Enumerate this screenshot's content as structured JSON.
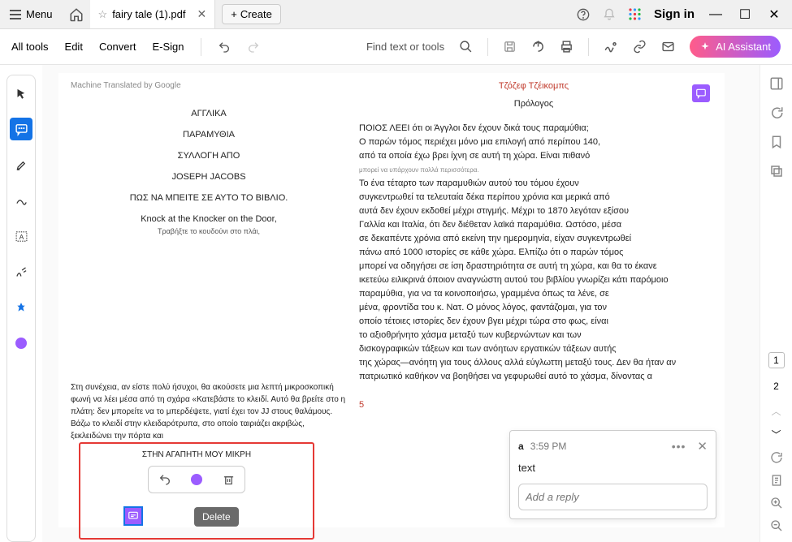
{
  "titlebar": {
    "menu": "Menu",
    "tab_title": "fairy tale (1).pdf",
    "create": "Create",
    "signin": "Sign in"
  },
  "toolbar": {
    "all_tools": "All tools",
    "edit": "Edit",
    "convert": "Convert",
    "esign": "E-Sign",
    "search_label": "Find text or tools",
    "ai": "AI Assistant"
  },
  "doc": {
    "mt": "Machine Translated by Google",
    "left": {
      "l1": "ΑΓΓΛΙΚΑ",
      "l2": "ΠΑΡΑΜΥΘΙΑ",
      "l3": "ΣΥΛΛΟΓΗ ΑΠΟ",
      "l4": "JOSEPH JACOBS",
      "l5": "ΠΩΣ ΝΑ ΜΠΕΙΤΕ ΣΕ ΑΥΤΟ ΤΟ ΒΙΒΛΙΟ.",
      "l6": "Knock at the Knocker on the Door,",
      "l6s": "Τραβήξτε το κουδούνι στο πλάι,"
    },
    "narrative": "Στη συνέχεια, αν είστε πολύ ήσυχοι, θα ακούσετε μια λεπτή μικροσκοπική φωνή να λέει μέσα από τη σχάρα «Κατεβάστε το κλειδί.    Αυτό θα βρείτε στο η πλάτη: δεν μπορείτε να το μπερδέψετε, γιατί έχει τον JJ στους θαλάμους. Βάζω το κλειδί στην κλειδαρότρυπα, στο οποίο ταιριάζει ακριβώς, ξεκλειδώνει την πόρτα και",
    "hl": {
      "title": "ΣΤΗΝ ΑΓΑΠΗΤΗ ΜΟΥ ΜΙΚΡΗ",
      "delete": "Delete"
    },
    "right": {
      "author": "Τζόζεφ Τζέικομπς",
      "prolog": "Πρόλογος",
      "p1": "ΠΟΙΟΣ ΛΕΕΙ ότι οι Άγγλοι δεν έχουν δικά τους παραμύθια;",
      "p2": "Ο παρών τόμος περιέχει μόνο μια επιλογή από περίπου 140,",
      "p3": "από τα οποία έχω βρει ίχνη σε αυτή τη χώρα. Είναι πιθανό",
      "tiny": "μπορεί να υπάρχουν πολλά περισσότερα.",
      "p4": "    Το ένα τέταρτο των παραμυθιών αυτού του τόμου έχουν",
      "p5": "συγκεντρωθεί τα τελευταία δέκα περίπου χρόνια και μερικά από",
      "p6": "αυτά δεν έχουν εκδοθεί μέχρι στιγμής. Μέχρι το 1870 λεγόταν εξίσου",
      "p7": "Γαλλία και Ιταλία, ότι δεν διέθεταν λαϊκά παραμύθια. Ωστόσο, μέσα",
      "p8": "σε δεκαπέντε χρόνια από εκείνη την ημερομηνία, είχαν συγκεντρωθεί",
      "p9": "πάνω από 1000 ιστορίες σε κάθε χώρα. Ελπίζω ότι ο παρών τόμος",
      "p10": "μπορεί να οδηγήσει σε ίση δραστηριότητα σε αυτή τη χώρα, και θα το έκανε",
      "p11": "ικετεύω ειλικρινά όποιον αναγνώστη αυτού του βιβλίου γνωρίζει κάτι παρόμοιο",
      "p12": "παραμύθια, για να τα κοινοποιήσω, γραμμένα όπως τα λένε, σε",
      "p13": "μένα, φροντίδα του κ. Νατ. Ο μόνος λόγος, φαντάζομαι, για τον",
      "p14": "οποίο τέτοιες ιστορίες δεν έχουν βγει μέχρι τώρα στο φως, είναι",
      "p15": "το αξιοθρήνητο χάσμα μεταξύ των κυβερνώντων και των",
      "p16": "δισκογραφικών τάξεων και των ανόητων εργατικών τάξεων αυτής",
      "p17": "της χώρας—ανόητη για τους άλλους αλλά εύγλωττη μεταξύ τους. Δεν θα ήταν αν",
      "p18": "πατριωτικό καθήκον να βοηθήσει να γεφυρωθεί αυτό το χάσμα, δίνοντας α",
      "pgnum": "5"
    }
  },
  "comment": {
    "name": "a",
    "time": "3:59 PM",
    "body": "text",
    "reply_ph": "Add a reply"
  },
  "pages": {
    "p1": "1",
    "p2": "2"
  }
}
